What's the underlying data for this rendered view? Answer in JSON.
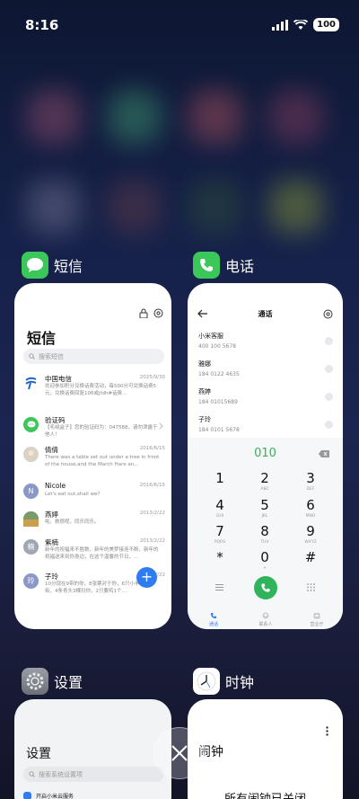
{
  "status_bar": {
    "time": "8:16",
    "battery": "100"
  },
  "cards": {
    "messages": {
      "app_name": "短信",
      "title": "短信",
      "search_placeholder": "搜索短信",
      "items": [
        {
          "name": "中国电信",
          "date": "2025/9/30",
          "preview": "欢迎参加积分兑换话费活动，每500分可兑换话费5元，兑换话费回复106或jfdh#话费…",
          "avatar_text": ""
        },
        {
          "name": "验证码",
          "date": "",
          "preview": "【毛绒盒子】您的验证码为：047588，请勿泄露于他人！",
          "avatar_text": ""
        },
        {
          "name": "倩倩",
          "date": "2016/6/15",
          "preview": "There was a table set out under a tree in front of the house,and the March Hare an…",
          "avatar_text": ""
        },
        {
          "name": "Nicole",
          "date": "2016/6/15",
          "preview": "Let's eat out,shall we?",
          "avatar_text": "N"
        },
        {
          "name": "燕婷",
          "date": "2013/2/22",
          "preview": "啦。救很呢，同乐同乐。",
          "avatar_text": ""
        },
        {
          "name": "紫楠",
          "date": "2013/2/22",
          "preview": "新年的祝福来不胜数，新年的美梦接连不断，新年的祝福送来到你身边，在这个温馨的节日，…",
          "avatar_text": "楠"
        },
        {
          "name": "子玲",
          "date": "2013/2/22",
          "preview": "10分现在9带的你，8张票对于你，6只小羊5只象街，4条青头3棵扫你，2只要鸡1个…",
          "avatar_text": "玲"
        }
      ]
    },
    "phone": {
      "app_name": "电话",
      "title": "通话",
      "contacts": [
        {
          "name": "小米客服",
          "number": "400 100 5678"
        },
        {
          "name": "雅娜",
          "number": "184 0122 4635"
        },
        {
          "name": "燕婷",
          "number": "184 01015689"
        },
        {
          "name": "子玲",
          "number": "184 0101 5678"
        }
      ],
      "dialed": "010",
      "keys": [
        {
          "digit": "1",
          "letters": ""
        },
        {
          "digit": "2",
          "letters": "ABC"
        },
        {
          "digit": "3",
          "letters": "DEF"
        },
        {
          "digit": "4",
          "letters": "GHI"
        },
        {
          "digit": "5",
          "letters": "JKL"
        },
        {
          "digit": "6",
          "letters": "MNO"
        },
        {
          "digit": "7",
          "letters": "PQRS"
        },
        {
          "digit": "8",
          "letters": "TUV"
        },
        {
          "digit": "9",
          "letters": "WXYZ"
        },
        {
          "digit": "*",
          "letters": ""
        },
        {
          "digit": "0",
          "letters": "+"
        },
        {
          "digit": "#",
          "letters": ""
        }
      ],
      "tabs": [
        "通话",
        "联系人",
        "营业厅"
      ]
    },
    "settings": {
      "app_name": "设置",
      "title": "设置",
      "search_placeholder": "搜索系统设置项",
      "first_item": "开启小米云服务"
    },
    "clock": {
      "app_name": "时钟",
      "title": "闹钟",
      "status": "所有闹钟已关闭"
    }
  },
  "colors": {
    "accent_green": "#2fb35b",
    "accent_blue": "#2f7cf0"
  }
}
